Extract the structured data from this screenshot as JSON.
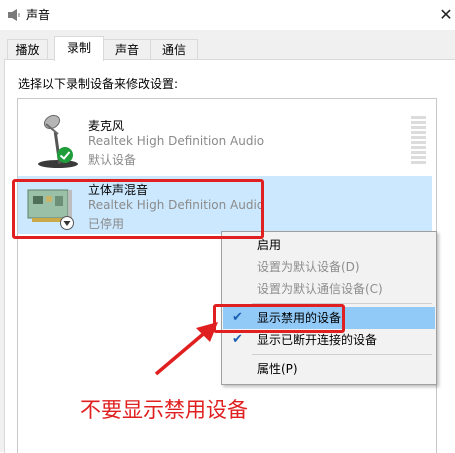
{
  "window": {
    "title": "声音"
  },
  "tabs": [
    {
      "label": "播放"
    },
    {
      "label": "录制"
    },
    {
      "label": "声音"
    },
    {
      "label": "通信"
    }
  ],
  "instruction": "选择以下录制设备来修改设置:",
  "devices": [
    {
      "name": "麦克风",
      "driver": "Realtek High Definition Audio",
      "status": "默认设备",
      "icon": "microphone-icon"
    },
    {
      "name": "立体声混音",
      "driver": "Realtek High Definition Audio",
      "status": "已停用",
      "icon": "sound-card-icon"
    }
  ],
  "context_menu": {
    "items": [
      {
        "label": "启用",
        "enabled": true,
        "checked": false
      },
      {
        "label": "设置为默认设备(D)",
        "enabled": false,
        "checked": false
      },
      {
        "label": "设置为默认通信设备(C)",
        "enabled": false,
        "checked": false
      },
      {
        "label": "显示禁用的设备",
        "enabled": true,
        "checked": true
      },
      {
        "label": "显示已断开连接的设备",
        "enabled": true,
        "checked": true
      },
      {
        "label": "属性(P)",
        "enabled": true,
        "checked": false
      }
    ]
  },
  "annotation": {
    "text": "不要显示禁用设备",
    "color": "#e02020"
  },
  "colors": {
    "selection": "#cce8ff",
    "menu_highlight": "#91c9f7",
    "annotation": "#e02020"
  }
}
